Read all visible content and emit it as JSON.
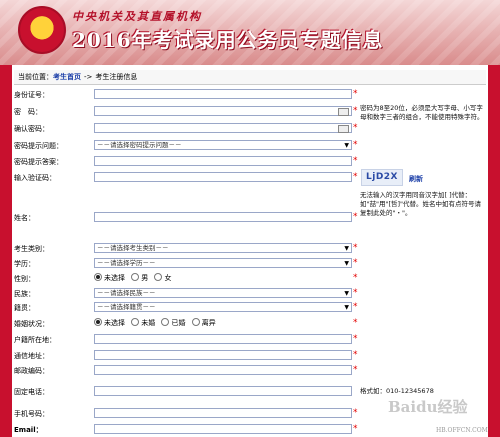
{
  "header": {
    "brand_line": "中央机关及其直属机构",
    "site_title": "2016年考试录用公务员专题信息"
  },
  "breadcrumb": {
    "label": "当前位置：",
    "home": "考生首页",
    "separator": "->",
    "current": "考生注册信息"
  },
  "form": {
    "id_number_label": "身份证号：",
    "password_label": "密　码：",
    "confirm_password_label": "确认密码：",
    "pw_question_label": "密码提示问题：",
    "pw_question_value": "－－请选择密码提示问题－－",
    "pw_answer_label": "密码提示答案：",
    "captcha_label": "输入验证码：",
    "captcha_text": "LjD2X",
    "refresh_label": "刷新",
    "name_label": "姓名：",
    "candidate_type_label": "考生类别：",
    "candidate_type_value": "－－请选择考生类别－－",
    "education_label": "学历：",
    "education_value": "－－请选择学历－－",
    "gender_label": "性别：",
    "gender_options": [
      "未选择",
      "男",
      "女"
    ],
    "ethnicity_label": "民族：",
    "ethnicity_value": "－－请选择民族－－",
    "hometown_label": "籍贯：",
    "hometown_value": "－－请选择籍贯－－",
    "marital_label": "婚姻状况：",
    "marital_options": [
      "未选择",
      "未婚",
      "已婚",
      "离异"
    ],
    "hukou_label": "户籍所在地：",
    "address_label": "通信地址：",
    "postcode_label": "邮政编码：",
    "phone_label": "固定电话：",
    "phone_format": "格式如：010-12345678",
    "mobile_label": "手机号码：",
    "email_label": "Email："
  },
  "hints": {
    "password": "密码为8至20位，必须是大写字母、小写字母和数字三者的组合，不能使用特殊字符。",
    "name": "无法输入的汉字用同音汉字加[ ]代替：如\"喆\"用\"[哲]\"代替。姓名中如有点符号请复制此处的\"・\"。"
  },
  "watermark": {
    "brand": "Baidu经验",
    "domain": "HB.OFFCN.COM"
  },
  "colors": {
    "accent_red": "#c8102e",
    "link_blue": "#1c3fa8",
    "required_red": "#e30000"
  }
}
